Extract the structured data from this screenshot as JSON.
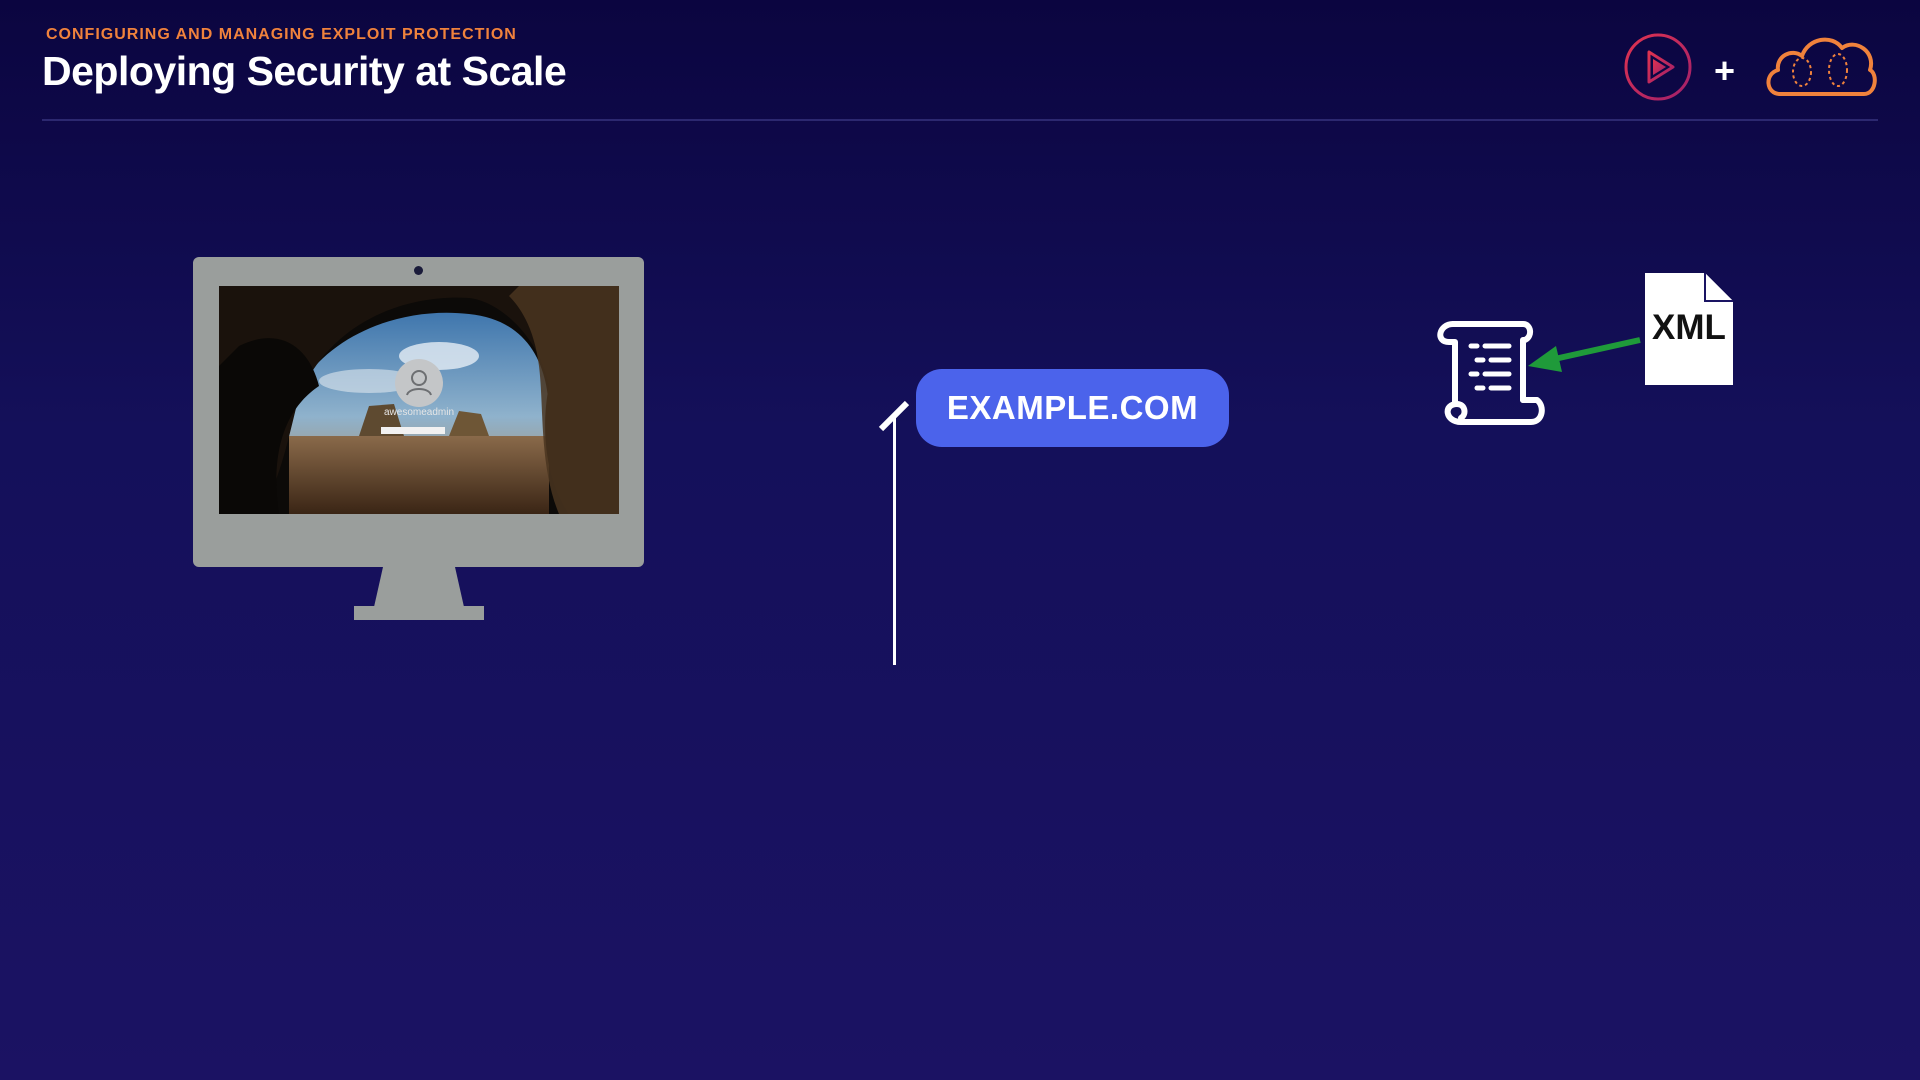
{
  "header": {
    "kicker": "CONFIGURING AND MANAGING EXPLOIT PROTECTION",
    "title": "Deploying Security at Scale",
    "plus": "+"
  },
  "login_screen": {
    "username": "awesomeadmin"
  },
  "domain": {
    "label": "EXAMPLE.COM"
  },
  "policy": {
    "file_label": "XML"
  },
  "colors": {
    "accent_orange": "#f0823c",
    "pill_blue": "#4b63eb",
    "arrow_green": "#1f9a3a",
    "logo_red": "#e0334f"
  }
}
